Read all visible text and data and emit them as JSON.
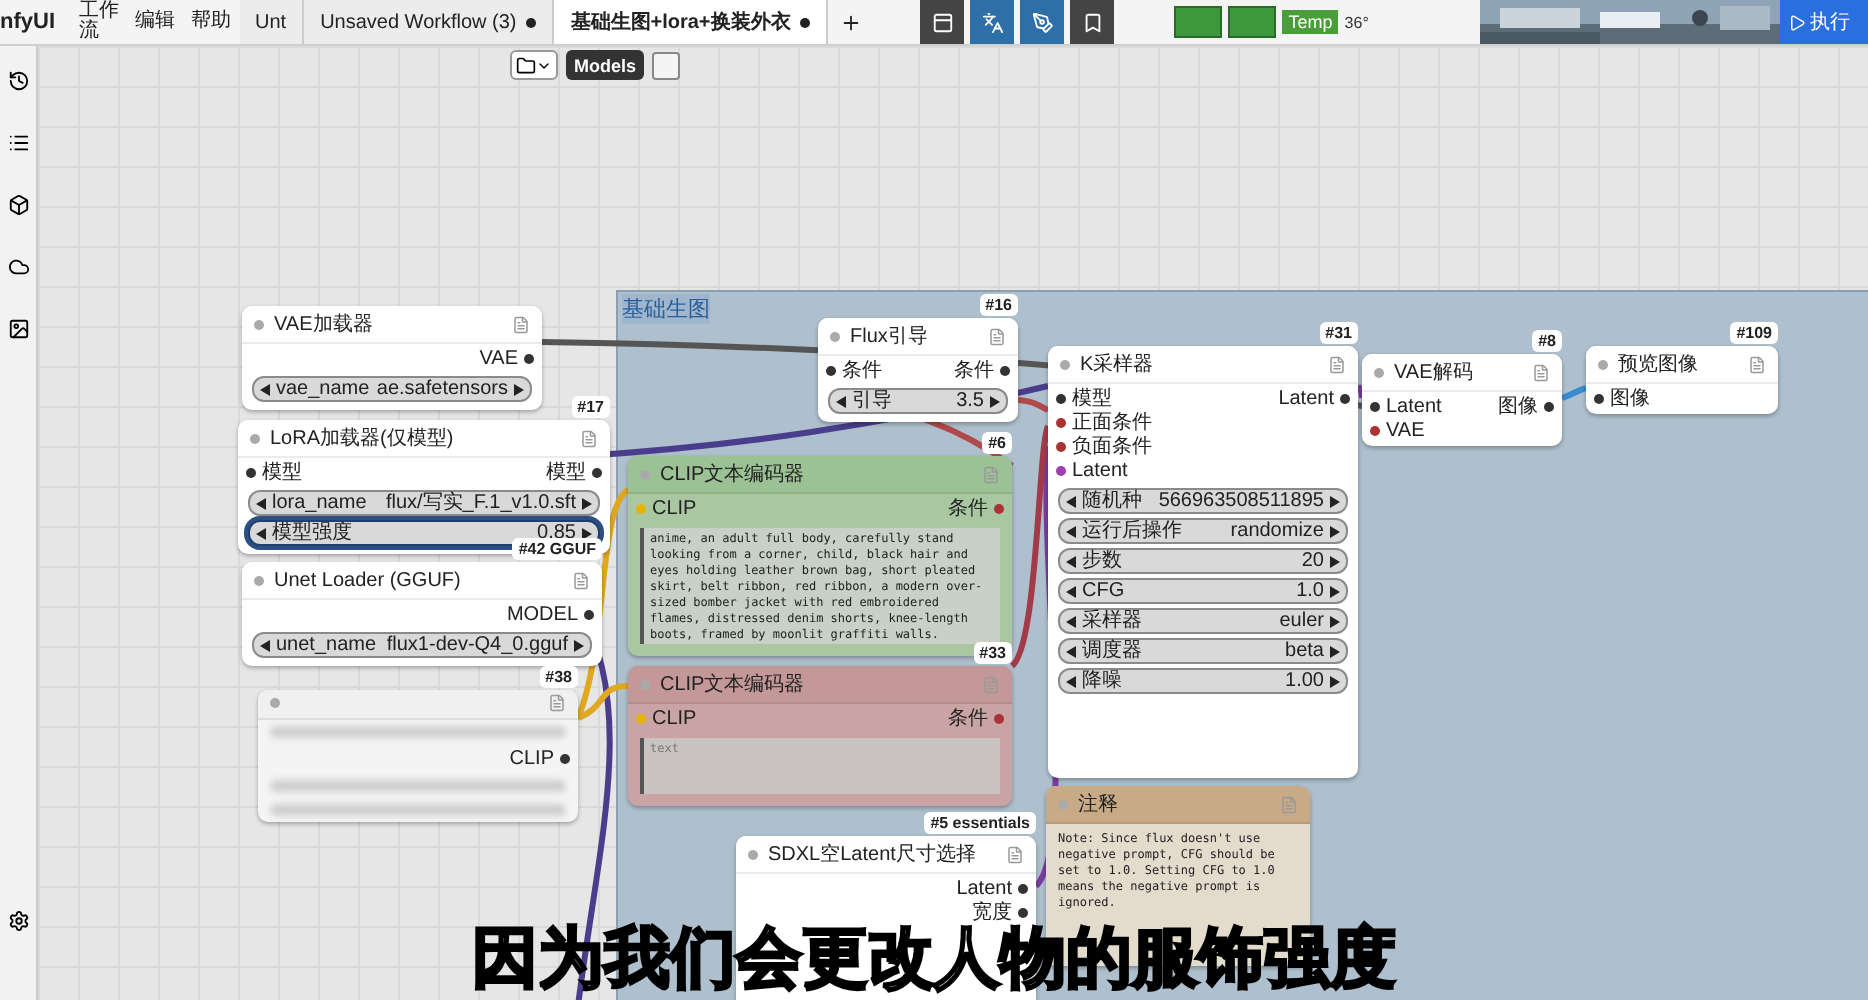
{
  "topbar": {
    "app_name": "nfyUI",
    "menu": [
      "工作流",
      "编辑",
      "帮助"
    ],
    "tabs": [
      {
        "label": "Unt",
        "selected": false,
        "unsaved": false
      },
      {
        "label": "Unsaved Workflow (3)",
        "selected": false,
        "unsaved": true
      },
      {
        "label": "基础生图+lora+换装外衣",
        "selected": true,
        "unsaved": true
      }
    ],
    "tools": [
      {
        "kind": "panel",
        "active": false
      },
      {
        "kind": "translate",
        "active": true
      },
      {
        "kind": "brush",
        "active": true
      },
      {
        "kind": "bookmark",
        "active": false
      }
    ],
    "monitor": {
      "label": "Temp",
      "reading": "36°"
    },
    "preview": {
      "kind": "picture"
    },
    "run_button": "执行"
  },
  "canvas_toolbar": {
    "models_button": "Models"
  },
  "group": {
    "title": "基础生图"
  },
  "nodes": [
    {
      "kind": "plain",
      "title": "VAE加载器",
      "outputs": [
        "VAE"
      ],
      "widgets": [
        {
          "label": "vae_name",
          "value": "ae.safetensors",
          "selected": false
        }
      ]
    },
    {
      "kind": "plain",
      "badge": "#17",
      "title": "LoRA加载器(仅模型)",
      "inputs": [
        "模型"
      ],
      "outputs": [
        "模型"
      ],
      "widgets": [
        {
          "label": "lora_name",
          "value": "flux/写实_F.1_v1.0.sft",
          "selected": false
        },
        {
          "label": "模型强度",
          "value": "0.85",
          "selected": true
        }
      ]
    },
    {
      "kind": "plain",
      "badge": "#42 GGUF",
      "title": "Unet Loader (GGUF)",
      "outputs": [
        "MODEL"
      ],
      "widgets": [
        {
          "label": "unet_name",
          "value": "flux1-dev-Q4_0.gguf",
          "selected": false
        }
      ]
    },
    {
      "kind": "blurred",
      "badge": "#38",
      "outputs": [
        "CLIP"
      ]
    },
    {
      "kind": "plain",
      "badge": "#16",
      "title": "Flux引导",
      "inputs": [
        "条件"
      ],
      "outputs": [
        "条件"
      ],
      "widgets": [
        {
          "label": "引导",
          "value": "3.5",
          "selected": false
        }
      ]
    },
    {
      "kind": "green",
      "badge": "#6",
      "title": "CLIP文本编码器",
      "inputs": [
        "CLIP"
      ],
      "outputs": [
        "条件"
      ],
      "text": "anime, an adult full body, carefully stand looking from a corner, child, black hair and eyes holding leather brown bag, short pleated skirt, belt ribbon, red ribbon, a modern over-sized bomber jacket with red embroidered flames, distressed denim shorts, knee-length boots, framed by moonlit graffiti walls."
    },
    {
      "kind": "red",
      "badge": "#33",
      "title": "CLIP文本编码器",
      "inputs": [
        "CLIP"
      ],
      "outputs": [
        "条件"
      ],
      "placeholder": "text"
    },
    {
      "kind": "plain",
      "badge": "#31",
      "title": "K采样器",
      "inputs": [
        "模型",
        "正面条件",
        "负面条件",
        "Latent"
      ],
      "outputs": [
        "Latent"
      ],
      "widgets": [
        {
          "label": "随机种",
          "value": "566963508511895",
          "selected": false
        },
        {
          "label": "运行后操作",
          "value": "randomize",
          "selected": false
        },
        {
          "label": "步数",
          "value": "20",
          "selected": false
        },
        {
          "label": "CFG",
          "value": "1.0",
          "selected": false
        },
        {
          "label": "采样器",
          "value": "euler",
          "selected": false
        },
        {
          "label": "调度器",
          "value": "beta",
          "selected": false
        },
        {
          "label": "降噪",
          "value": "1.00",
          "selected": false
        }
      ]
    },
    {
      "kind": "plain",
      "badge": "#8",
      "title": "VAE解码",
      "inputs": [
        "Latent",
        "VAE"
      ],
      "outputs": [
        "图像"
      ]
    },
    {
      "kind": "plain",
      "badge": "#109",
      "title": "预览图像",
      "inputs": [
        "图像"
      ]
    },
    {
      "kind": "plain",
      "badge": "#5 essentials",
      "title": "SDXL空Latent尺寸选择",
      "outputs": [
        "Latent",
        "宽度"
      ]
    },
    {
      "kind": "note",
      "title": "注释",
      "text": "Note: Since flux doesn't use negative prompt, CFG should be set to 1.0. Setting CFG to 1.0 means the negative prompt is ignored."
    }
  ],
  "subtitle": "因为我们会更改人物的服饰强度"
}
